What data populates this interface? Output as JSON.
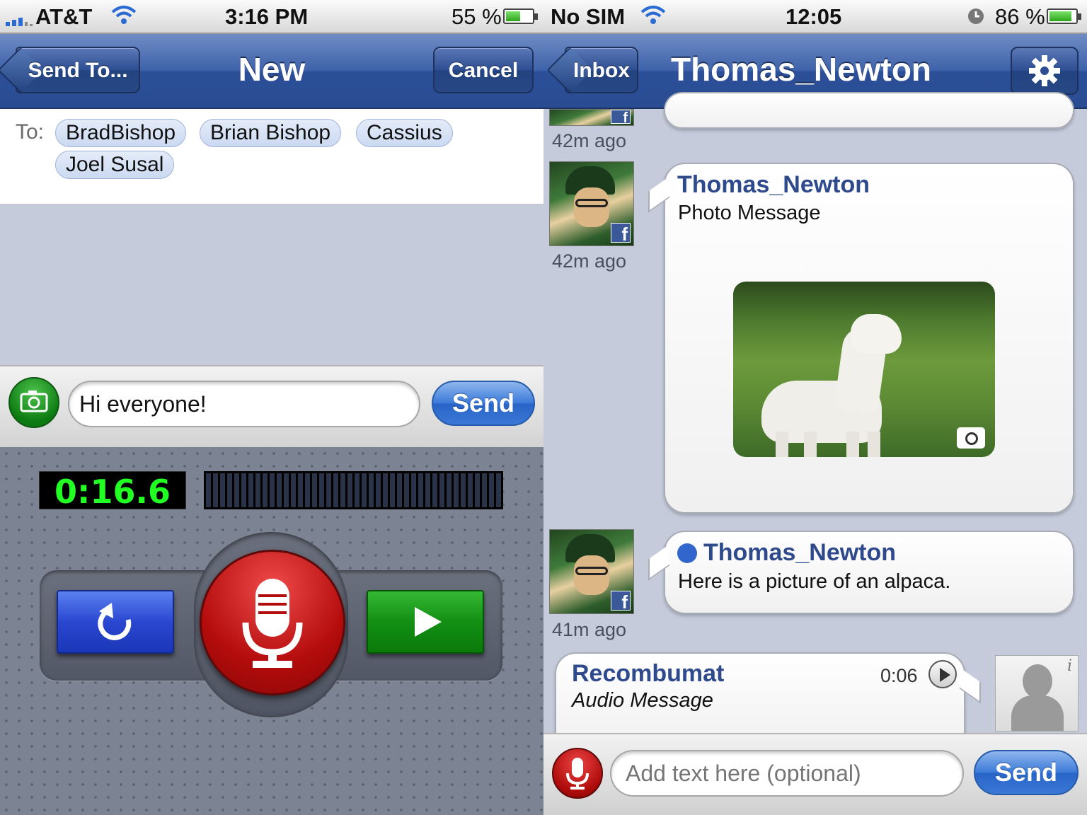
{
  "left": {
    "status": {
      "carrier": "AT&T",
      "time": "3:16 PM",
      "battery": "55 %",
      "battery_level": 0.55
    },
    "nav": {
      "back_label": "Send To...",
      "title": "New",
      "cancel_label": "Cancel"
    },
    "recipients": {
      "label": "To:",
      "chips": [
        "BradBishop",
        "Brian Bishop",
        "Cassius",
        "Joel Susal"
      ]
    },
    "compose": {
      "message": "Hi everyone!",
      "send_label": "Send"
    },
    "recorder": {
      "timer": "0:16.6"
    }
  },
  "right": {
    "status": {
      "carrier": "No SIM",
      "time": "12:05",
      "battery": "86 %",
      "battery_level": 0.86
    },
    "nav": {
      "back_label": "Inbox",
      "title": "Thomas_Newton"
    },
    "timestamps": [
      "42m ago",
      "42m ago",
      "41m ago"
    ],
    "messages": [
      {
        "sender": "Thomas_Newton",
        "text": "Photo Message"
      },
      {
        "sender": "Thomas_Newton",
        "text": "Here is a picture of an alpaca.",
        "unread": true
      },
      {
        "sender": "Recombumat",
        "text": "Audio Message",
        "duration": "0:06"
      }
    ],
    "compose": {
      "placeholder": "Add text here (optional)",
      "send_label": "Send"
    }
  },
  "colors": {
    "nav_blue": "#3e62aa",
    "send_blue": "#3b7ad8",
    "record_red": "#c81414",
    "play_green": "#138f13",
    "timer_green": "#22ff22",
    "sender_blue": "#2f4a8c"
  },
  "icons": [
    "wifi-icon",
    "battery-icon",
    "camera-icon",
    "microphone-icon",
    "reset-icon",
    "play-icon",
    "gear-icon",
    "facebook-icon",
    "clock-icon",
    "user-placeholder-icon"
  ]
}
